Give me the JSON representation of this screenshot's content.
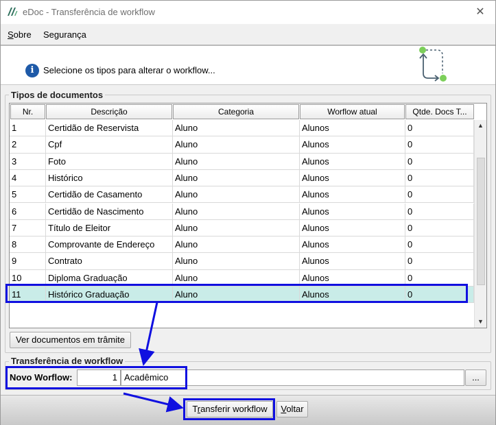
{
  "window": {
    "title": "eDoc - Transferência de workflow",
    "close_glyph": "✕"
  },
  "menu": {
    "items": [
      {
        "first": "S",
        "rest": "obre"
      },
      {
        "first": "",
        "rest": "Segurança"
      }
    ]
  },
  "info": {
    "icon_glyph": "i",
    "text": "Selecione os tipos para alterar o workflow..."
  },
  "documents_group": {
    "legend": "Tipos de documentos",
    "columns": [
      "Nr.",
      "Descrição",
      "Categoria",
      "Worflow atual",
      "Qtde. Docs T..."
    ],
    "rows": [
      [
        "1",
        "Certidão de Reservista",
        "Aluno",
        "Alunos",
        "0"
      ],
      [
        "2",
        "Cpf",
        "Aluno",
        "Alunos",
        "0"
      ],
      [
        "3",
        "Foto",
        "Aluno",
        "Alunos",
        "0"
      ],
      [
        "4",
        "Histórico",
        "Aluno",
        "Alunos",
        "0"
      ],
      [
        "5",
        "Certidão de Casamento",
        "Aluno",
        "Alunos",
        "0"
      ],
      [
        "6",
        "Certidão de Nascimento",
        "Aluno",
        "Alunos",
        "0"
      ],
      [
        "7",
        "Título de Eleitor",
        "Aluno",
        "Alunos",
        "0"
      ],
      [
        "8",
        "Comprovante de Endereço",
        "Aluno",
        "Alunos",
        "0"
      ],
      [
        "9",
        "Contrato",
        "Aluno",
        "Alunos",
        "0"
      ],
      [
        "10",
        "Diploma Graduação",
        "Aluno",
        "Alunos",
        "0"
      ],
      [
        "11",
        "Histórico Graduação",
        "Aluno",
        "Alunos",
        "0"
      ]
    ],
    "selected_row": 11,
    "button_label": "Ver documentos em trâmite"
  },
  "transfer_group": {
    "legend": "Transferência de workflow",
    "novo_label": "Novo Worflow:",
    "workflow_id": "1",
    "workflow_name": "Acadêmico",
    "browse_label": "..."
  },
  "footer": {
    "transfer_label_pre": "T",
    "transfer_label_u": "r",
    "transfer_label_post": "ansferir workflow",
    "back_label_u": "V",
    "back_label_post": "oltar"
  },
  "colors": {
    "selection": "#c9ece8",
    "annotation": "#1010e0",
    "info_icon": "#1e5aa8",
    "wf_icon_green": "#7ccf5a"
  }
}
